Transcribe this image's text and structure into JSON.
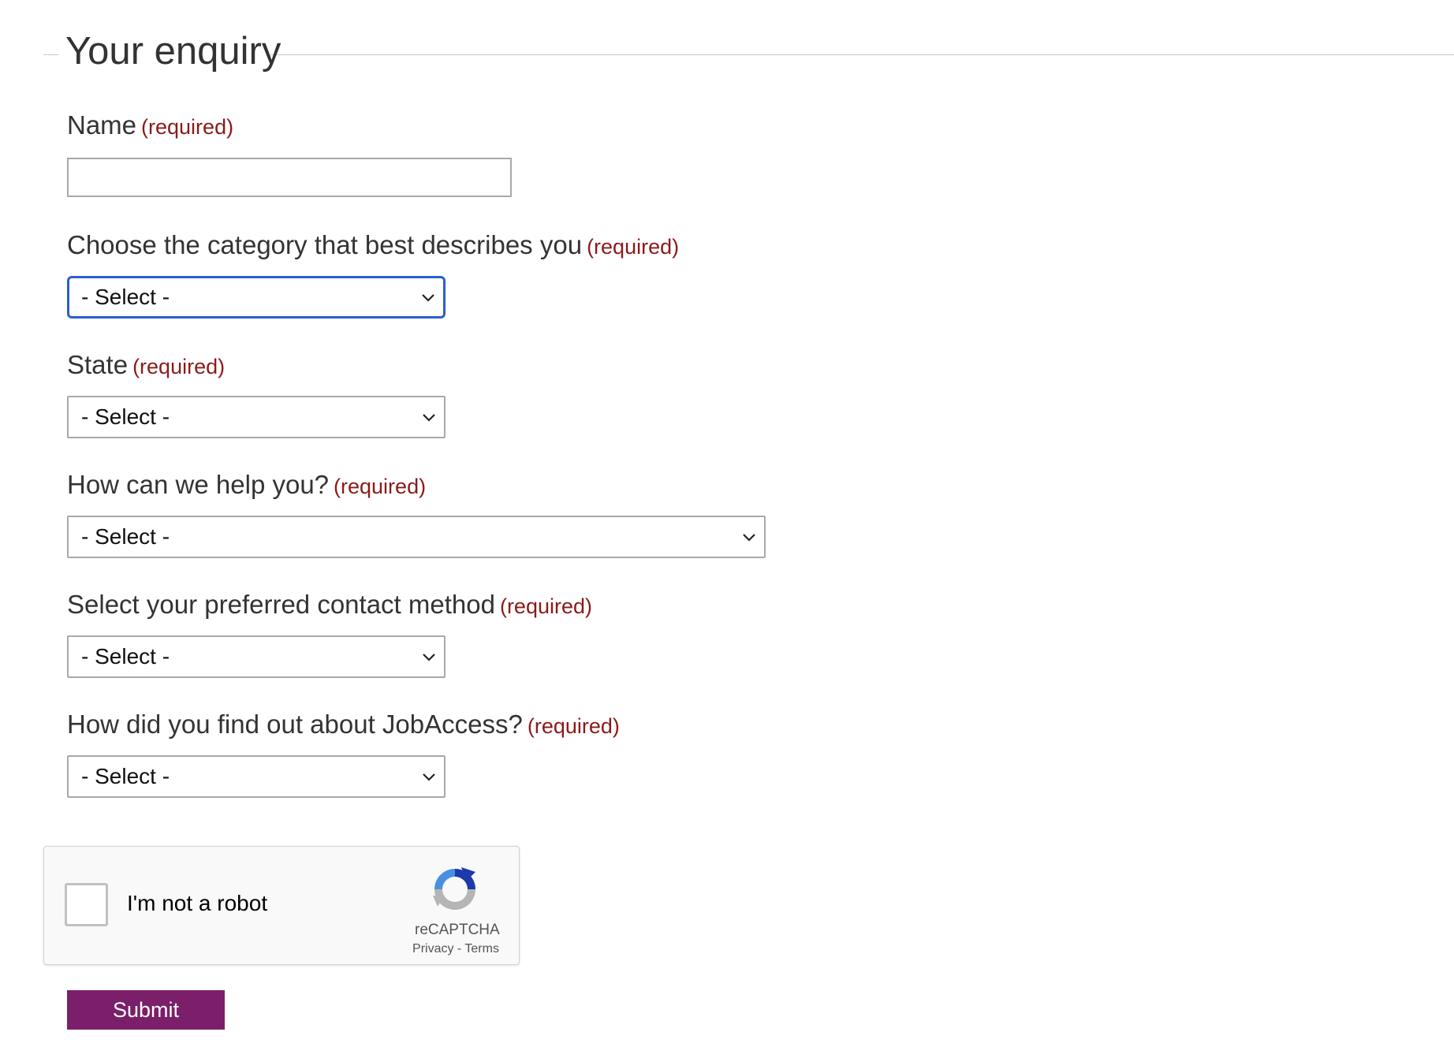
{
  "form": {
    "legend": "Your enquiry",
    "required_text": "(required)",
    "fields": [
      {
        "label": "Name",
        "type": "text",
        "value": ""
      },
      {
        "label": "Choose the category that best describes you",
        "type": "select",
        "value": "- Select -"
      },
      {
        "label": "State",
        "type": "select",
        "value": "- Select -"
      },
      {
        "label": "How can we help you?",
        "type": "select",
        "value": "- Select -"
      },
      {
        "label": "Select your preferred contact method",
        "type": "select",
        "value": "- Select -"
      },
      {
        "label": "How did you find out about JobAccess?",
        "type": "select",
        "value": "- Select -"
      }
    ]
  },
  "captcha": {
    "label": "I'm not a robot",
    "brand": "reCAPTCHA",
    "privacy": "Privacy",
    "separator": "-",
    "terms": "Terms",
    "checked": false
  },
  "submit": {
    "label": "Submit"
  },
  "colors": {
    "required": "#8b1a1a",
    "submit_bg": "#7b1f6a",
    "focus_border": "#2a5fd0"
  },
  "icons": {
    "select_arrow": "chevron-down-icon",
    "captcha_logo": "recaptcha-logo-icon"
  }
}
